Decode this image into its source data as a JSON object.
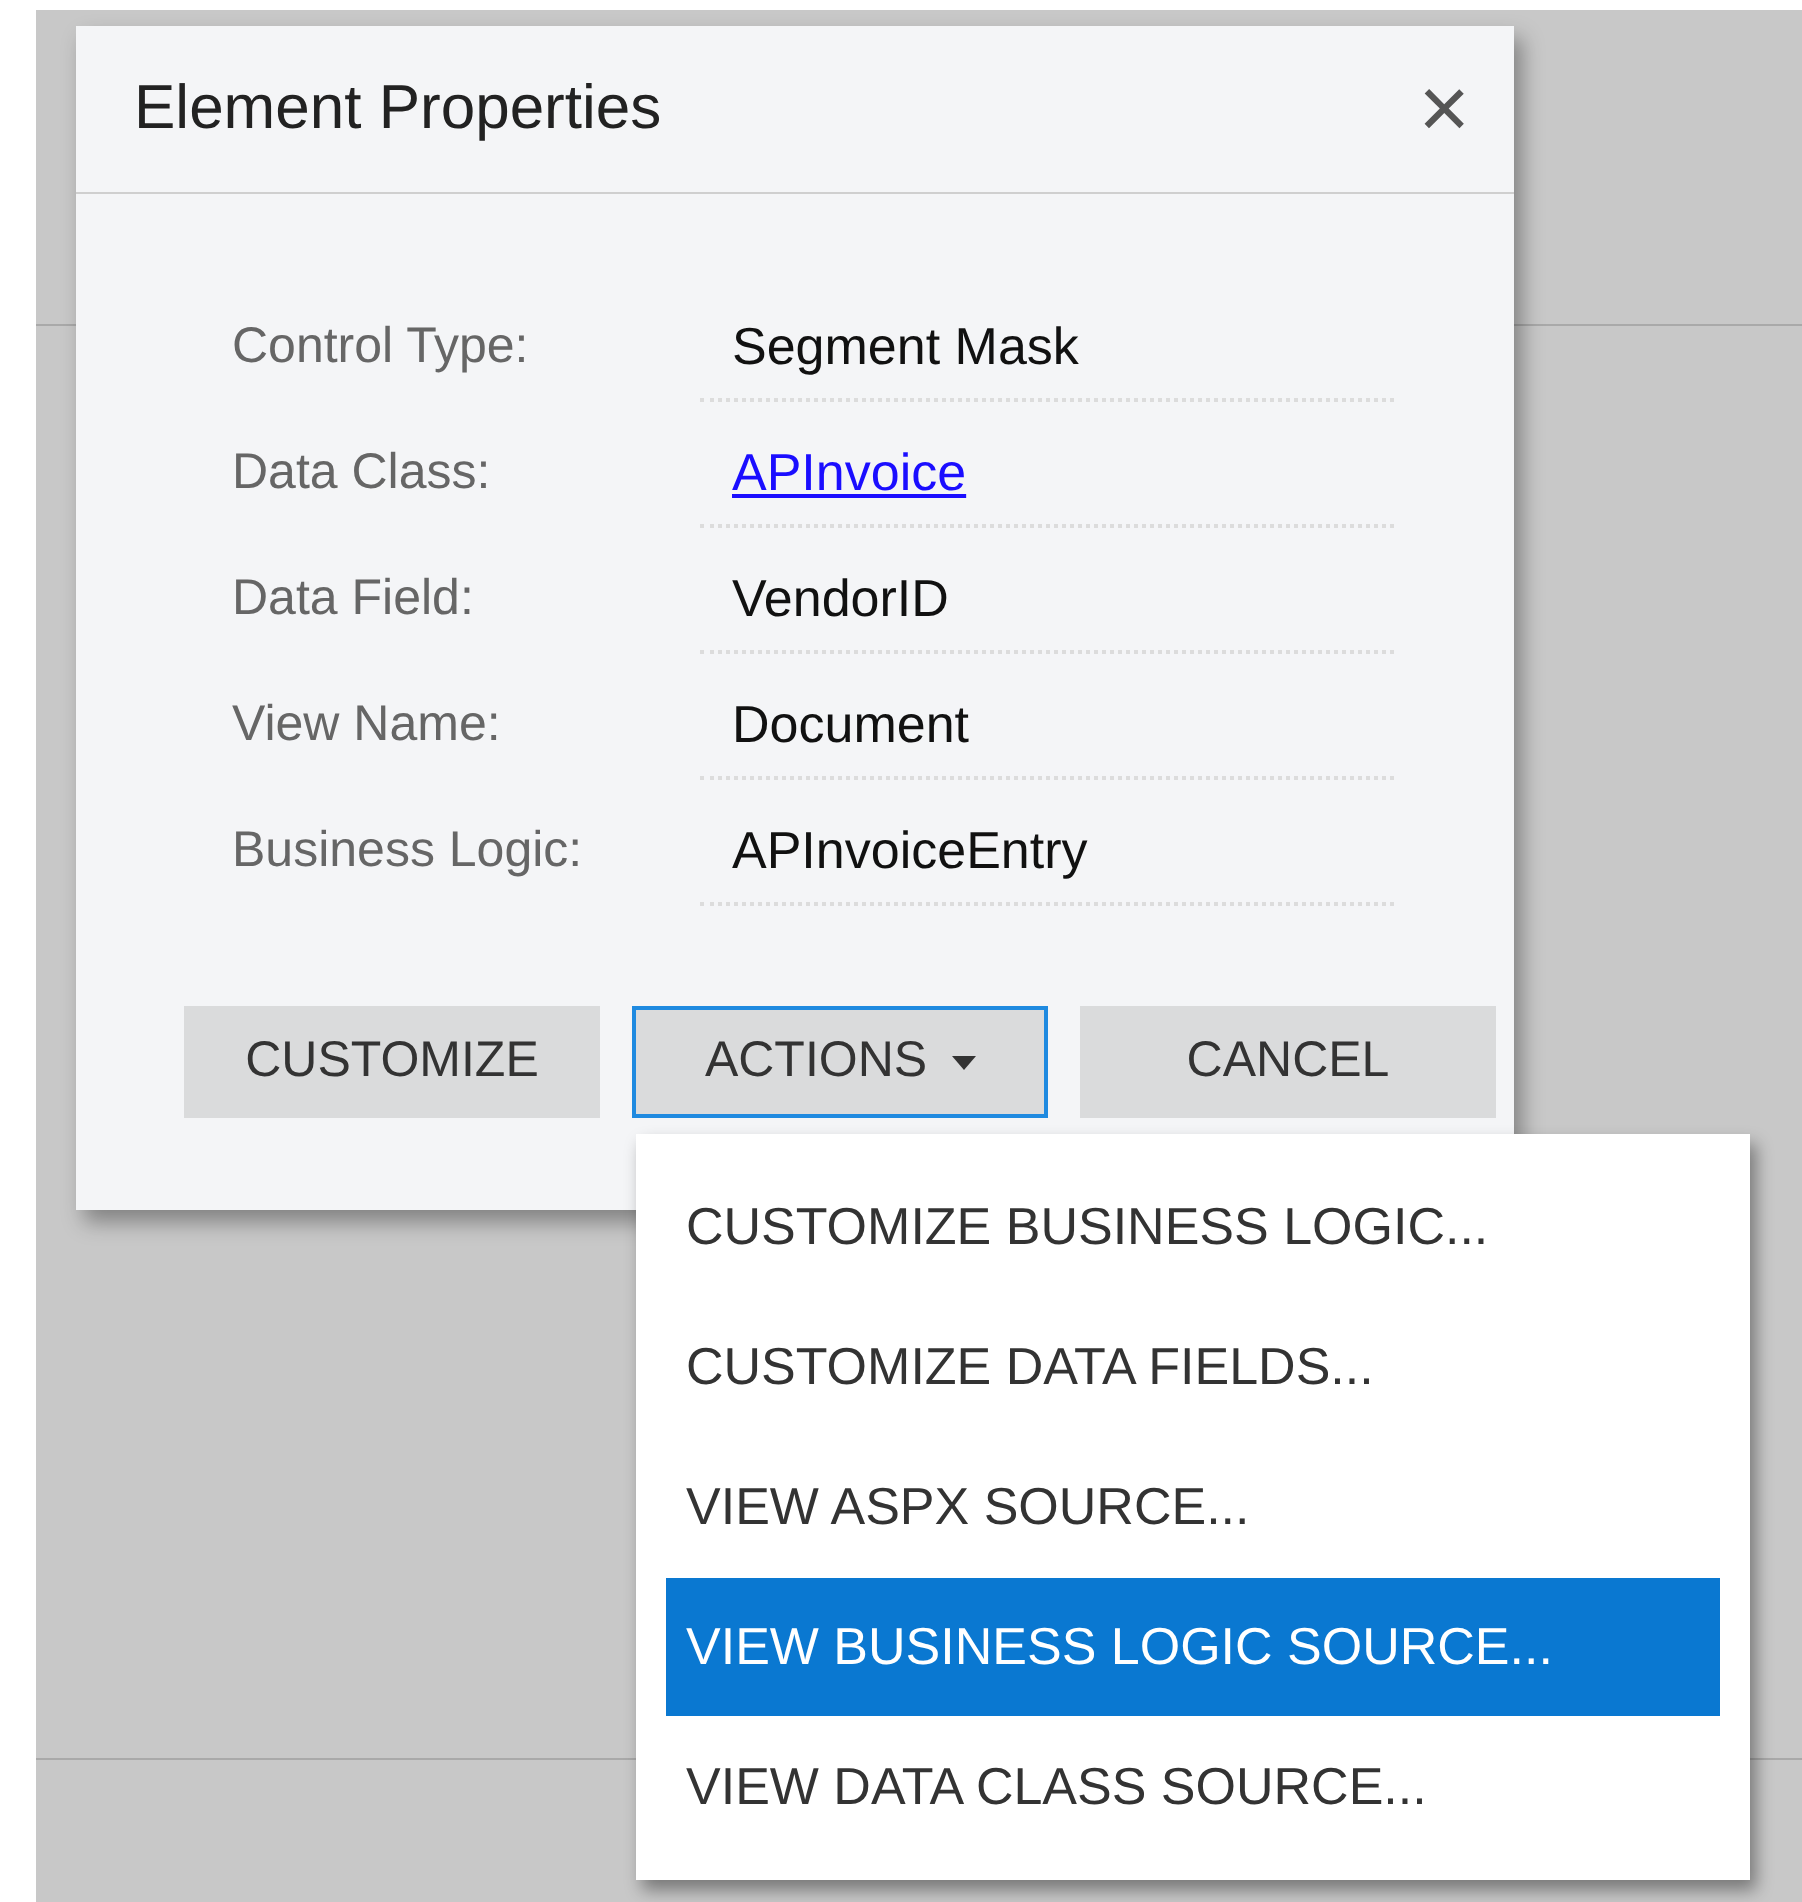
{
  "dialog": {
    "title": "Element Properties",
    "close": "×",
    "fields": [
      {
        "label": "Control Type:",
        "value": "Segment Mask",
        "kind": "text"
      },
      {
        "label": "Data Class:",
        "value": "APInvoice",
        "kind": "link"
      },
      {
        "label": "Data Field:",
        "value": "VendorID",
        "kind": "text"
      },
      {
        "label": "View Name:",
        "value": "Document",
        "kind": "text"
      },
      {
        "label": "Business Logic:",
        "value": "APInvoiceEntry",
        "kind": "text"
      }
    ],
    "buttons": [
      {
        "label": "CUSTOMIZE",
        "kind": "plain",
        "expanded": false
      },
      {
        "label": "ACTIONS",
        "kind": "dropdown",
        "expanded": true
      },
      {
        "label": "CANCEL",
        "kind": "plain",
        "expanded": false
      }
    ]
  },
  "menu": {
    "items": [
      {
        "label": "CUSTOMIZE BUSINESS LOGIC...",
        "selected": false
      },
      {
        "label": "CUSTOMIZE DATA FIELDS...",
        "selected": false
      },
      {
        "label": "VIEW ASPX SOURCE...",
        "selected": false
      },
      {
        "label": "VIEW BUSINESS LOGIC SOURCE...",
        "selected": true
      },
      {
        "label": "VIEW DATA CLASS SOURCE...",
        "selected": false
      }
    ]
  }
}
